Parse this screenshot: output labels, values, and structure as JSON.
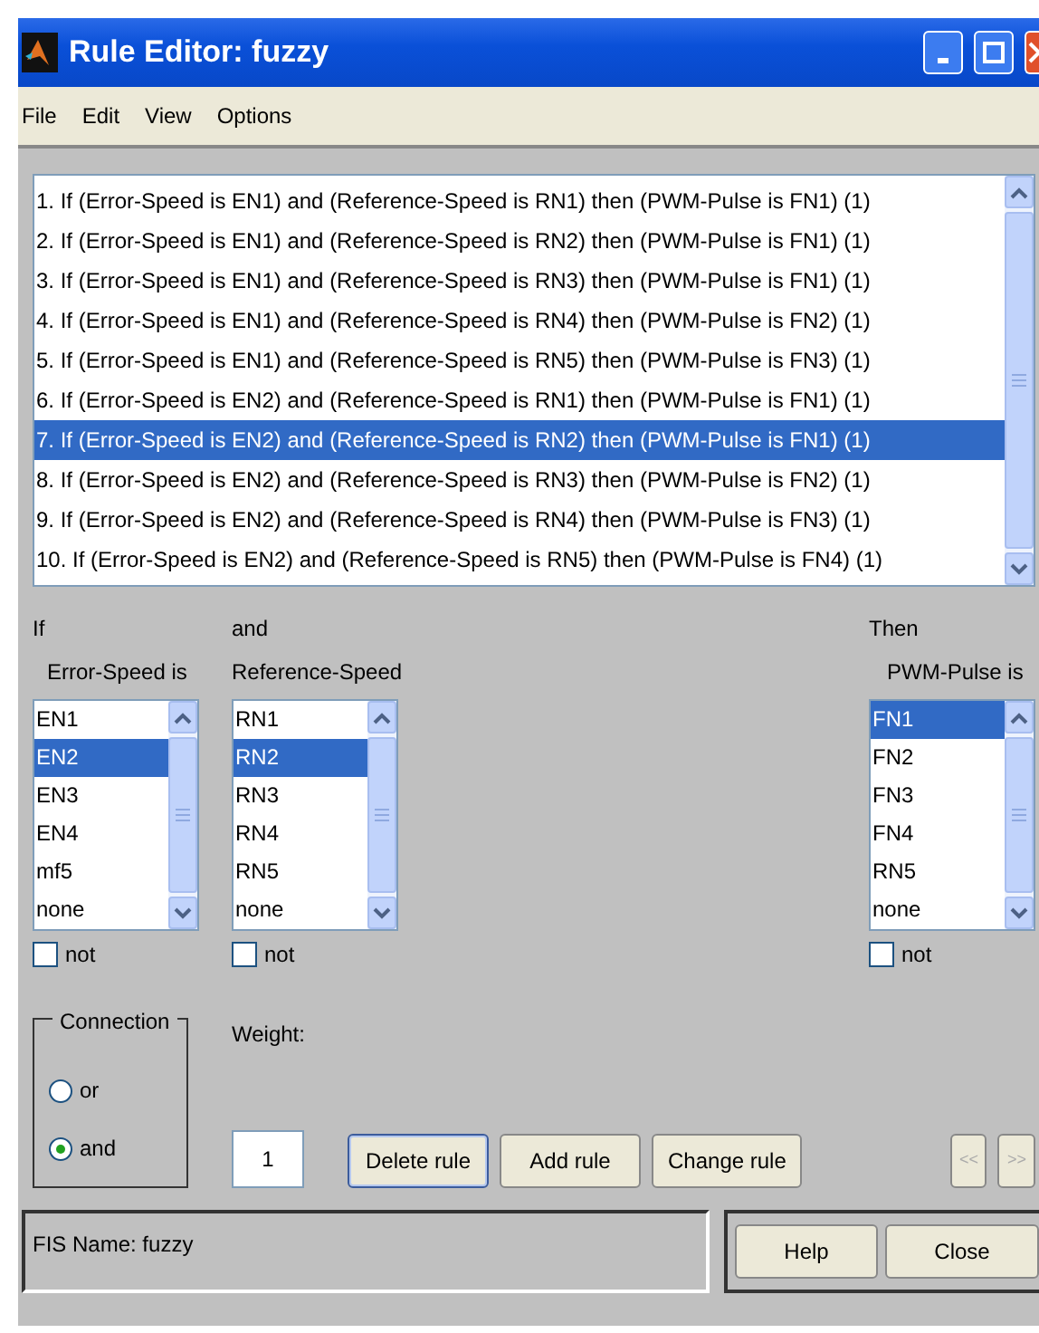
{
  "window": {
    "title": "Rule Editor: fuzzy"
  },
  "menu": [
    "File",
    "Edit",
    "View",
    "Options"
  ],
  "rules": [
    {
      "text": "1. If (Error-Speed is EN1) and (Reference-Speed is RN1) then (PWM-Pulse is FN1) (1)",
      "selected": false
    },
    {
      "text": "2. If (Error-Speed is EN1) and (Reference-Speed is RN2) then (PWM-Pulse is FN1) (1)",
      "selected": false
    },
    {
      "text": "3. If (Error-Speed is EN1) and (Reference-Speed is RN3) then (PWM-Pulse is FN1) (1)",
      "selected": false
    },
    {
      "text": "4. If (Error-Speed is EN1) and (Reference-Speed is RN4) then (PWM-Pulse is FN2) (1)",
      "selected": false
    },
    {
      "text": "5. If (Error-Speed is EN1) and (Reference-Speed is RN5) then (PWM-Pulse is FN3) (1)",
      "selected": false
    },
    {
      "text": "6. If (Error-Speed is EN2) and (Reference-Speed is RN1) then (PWM-Pulse is FN1) (1)",
      "selected": false
    },
    {
      "text": "7. If (Error-Speed is EN2) and (Reference-Speed is RN2) then (PWM-Pulse is FN1) (1)",
      "selected": true
    },
    {
      "text": "8. If (Error-Speed is EN2) and (Reference-Speed is RN3) then (PWM-Pulse is FN2) (1)",
      "selected": false
    },
    {
      "text": "9. If (Error-Speed is EN2) and (Reference-Speed is RN4) then (PWM-Pulse is FN3) (1)",
      "selected": false
    },
    {
      "text": "10. If (Error-Speed is EN2) and (Reference-Speed is RN5) then (PWM-Pulse is FN4) (1)",
      "selected": false
    }
  ],
  "variables": [
    {
      "kind": "input",
      "heading": "If",
      "label": "Error-Speed is",
      "not_label": "not",
      "not_checked": false,
      "options": [
        {
          "label": "EN1",
          "selected": false
        },
        {
          "label": "EN2",
          "selected": true
        },
        {
          "label": "EN3",
          "selected": false
        },
        {
          "label": "EN4",
          "selected": false
        },
        {
          "label": "mf5",
          "selected": false
        },
        {
          "label": "none",
          "selected": false
        }
      ]
    },
    {
      "kind": "input",
      "heading": "and",
      "label": "Reference-Speed",
      "not_label": "not",
      "not_checked": false,
      "options": [
        {
          "label": "RN1",
          "selected": false
        },
        {
          "label": "RN2",
          "selected": true
        },
        {
          "label": "RN3",
          "selected": false
        },
        {
          "label": "RN4",
          "selected": false
        },
        {
          "label": "RN5",
          "selected": false
        },
        {
          "label": "none",
          "selected": false
        }
      ]
    },
    {
      "kind": "output",
      "heading": "Then",
      "label": "PWM-Pulse is",
      "not_label": "not",
      "not_checked": false,
      "options": [
        {
          "label": "FN1",
          "selected": true
        },
        {
          "label": "FN2",
          "selected": false
        },
        {
          "label": "FN3",
          "selected": false
        },
        {
          "label": "FN4",
          "selected": false
        },
        {
          "label": "RN5",
          "selected": false
        },
        {
          "label": "none",
          "selected": false
        }
      ]
    }
  ],
  "connection": {
    "title": "Connection",
    "options": [
      {
        "label": "or",
        "selected": false
      },
      {
        "label": "and",
        "selected": true
      }
    ]
  },
  "weight": {
    "label": "Weight:",
    "value": "1"
  },
  "rule_buttons": [
    {
      "label": "Delete rule",
      "focused": true
    },
    {
      "label": "Add rule",
      "focused": false
    },
    {
      "label": "Change rule",
      "focused": false
    }
  ],
  "nav_buttons": [
    {
      "label": "<<",
      "disabled": true
    },
    {
      "label": ">>",
      "disabled": true
    }
  ],
  "status": "FIS Name: fuzzy",
  "footer_buttons": [
    "Help",
    "Close"
  ]
}
